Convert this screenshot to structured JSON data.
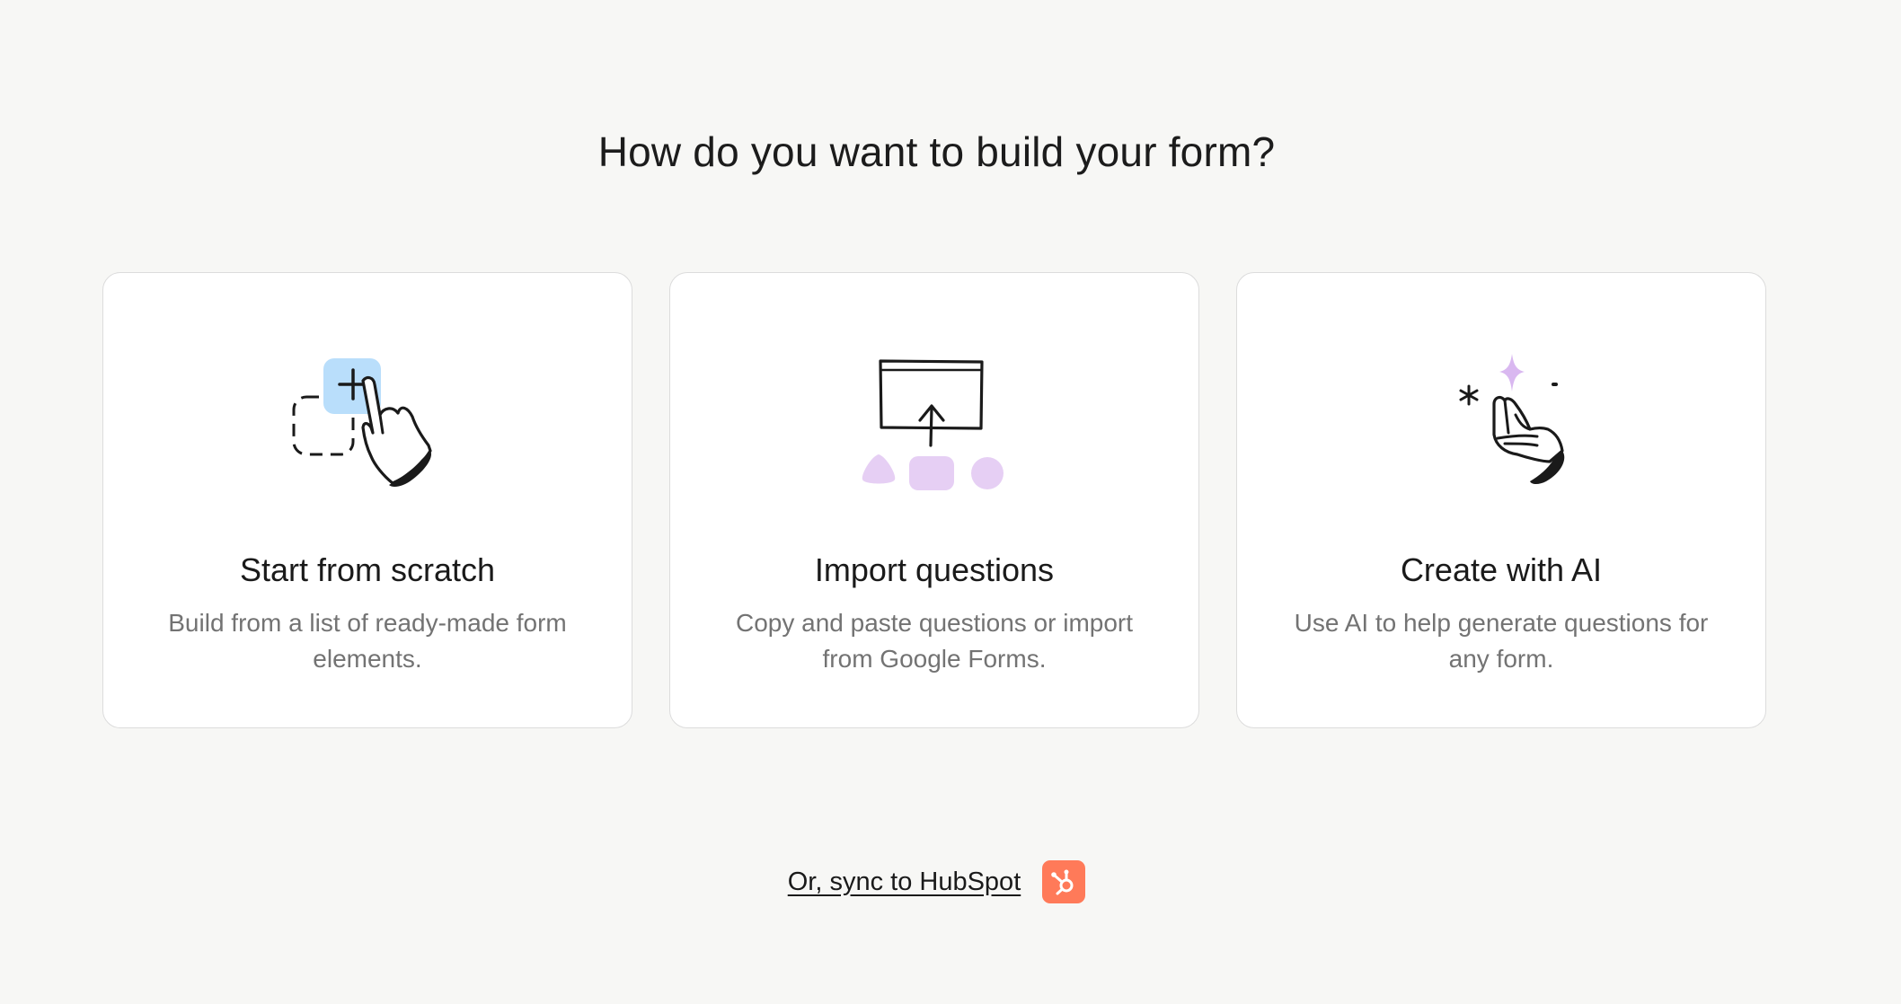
{
  "heading": "How do you want to build your form?",
  "cards": [
    {
      "title": "Start from scratch",
      "description": "Build from a list of ready-made form elements.",
      "icon": "hand-pointer-add-icon"
    },
    {
      "title": "Import questions",
      "description": "Copy and paste questions or import from Google Forms.",
      "icon": "import-upload-icon"
    },
    {
      "title": "Create with AI",
      "description": "Use AI to help generate questions for any form.",
      "icon": "ai-sparkle-hand-icon"
    }
  ],
  "footer": {
    "sync_label": "Or, sync to HubSpot",
    "icon": "hubspot-icon"
  },
  "colors": {
    "background": "#f7f7f5",
    "card_background": "#ffffff",
    "accent_blue": "#b9defb",
    "accent_purple": "#e6cff4",
    "hubspot_orange": "#ff7a59"
  }
}
